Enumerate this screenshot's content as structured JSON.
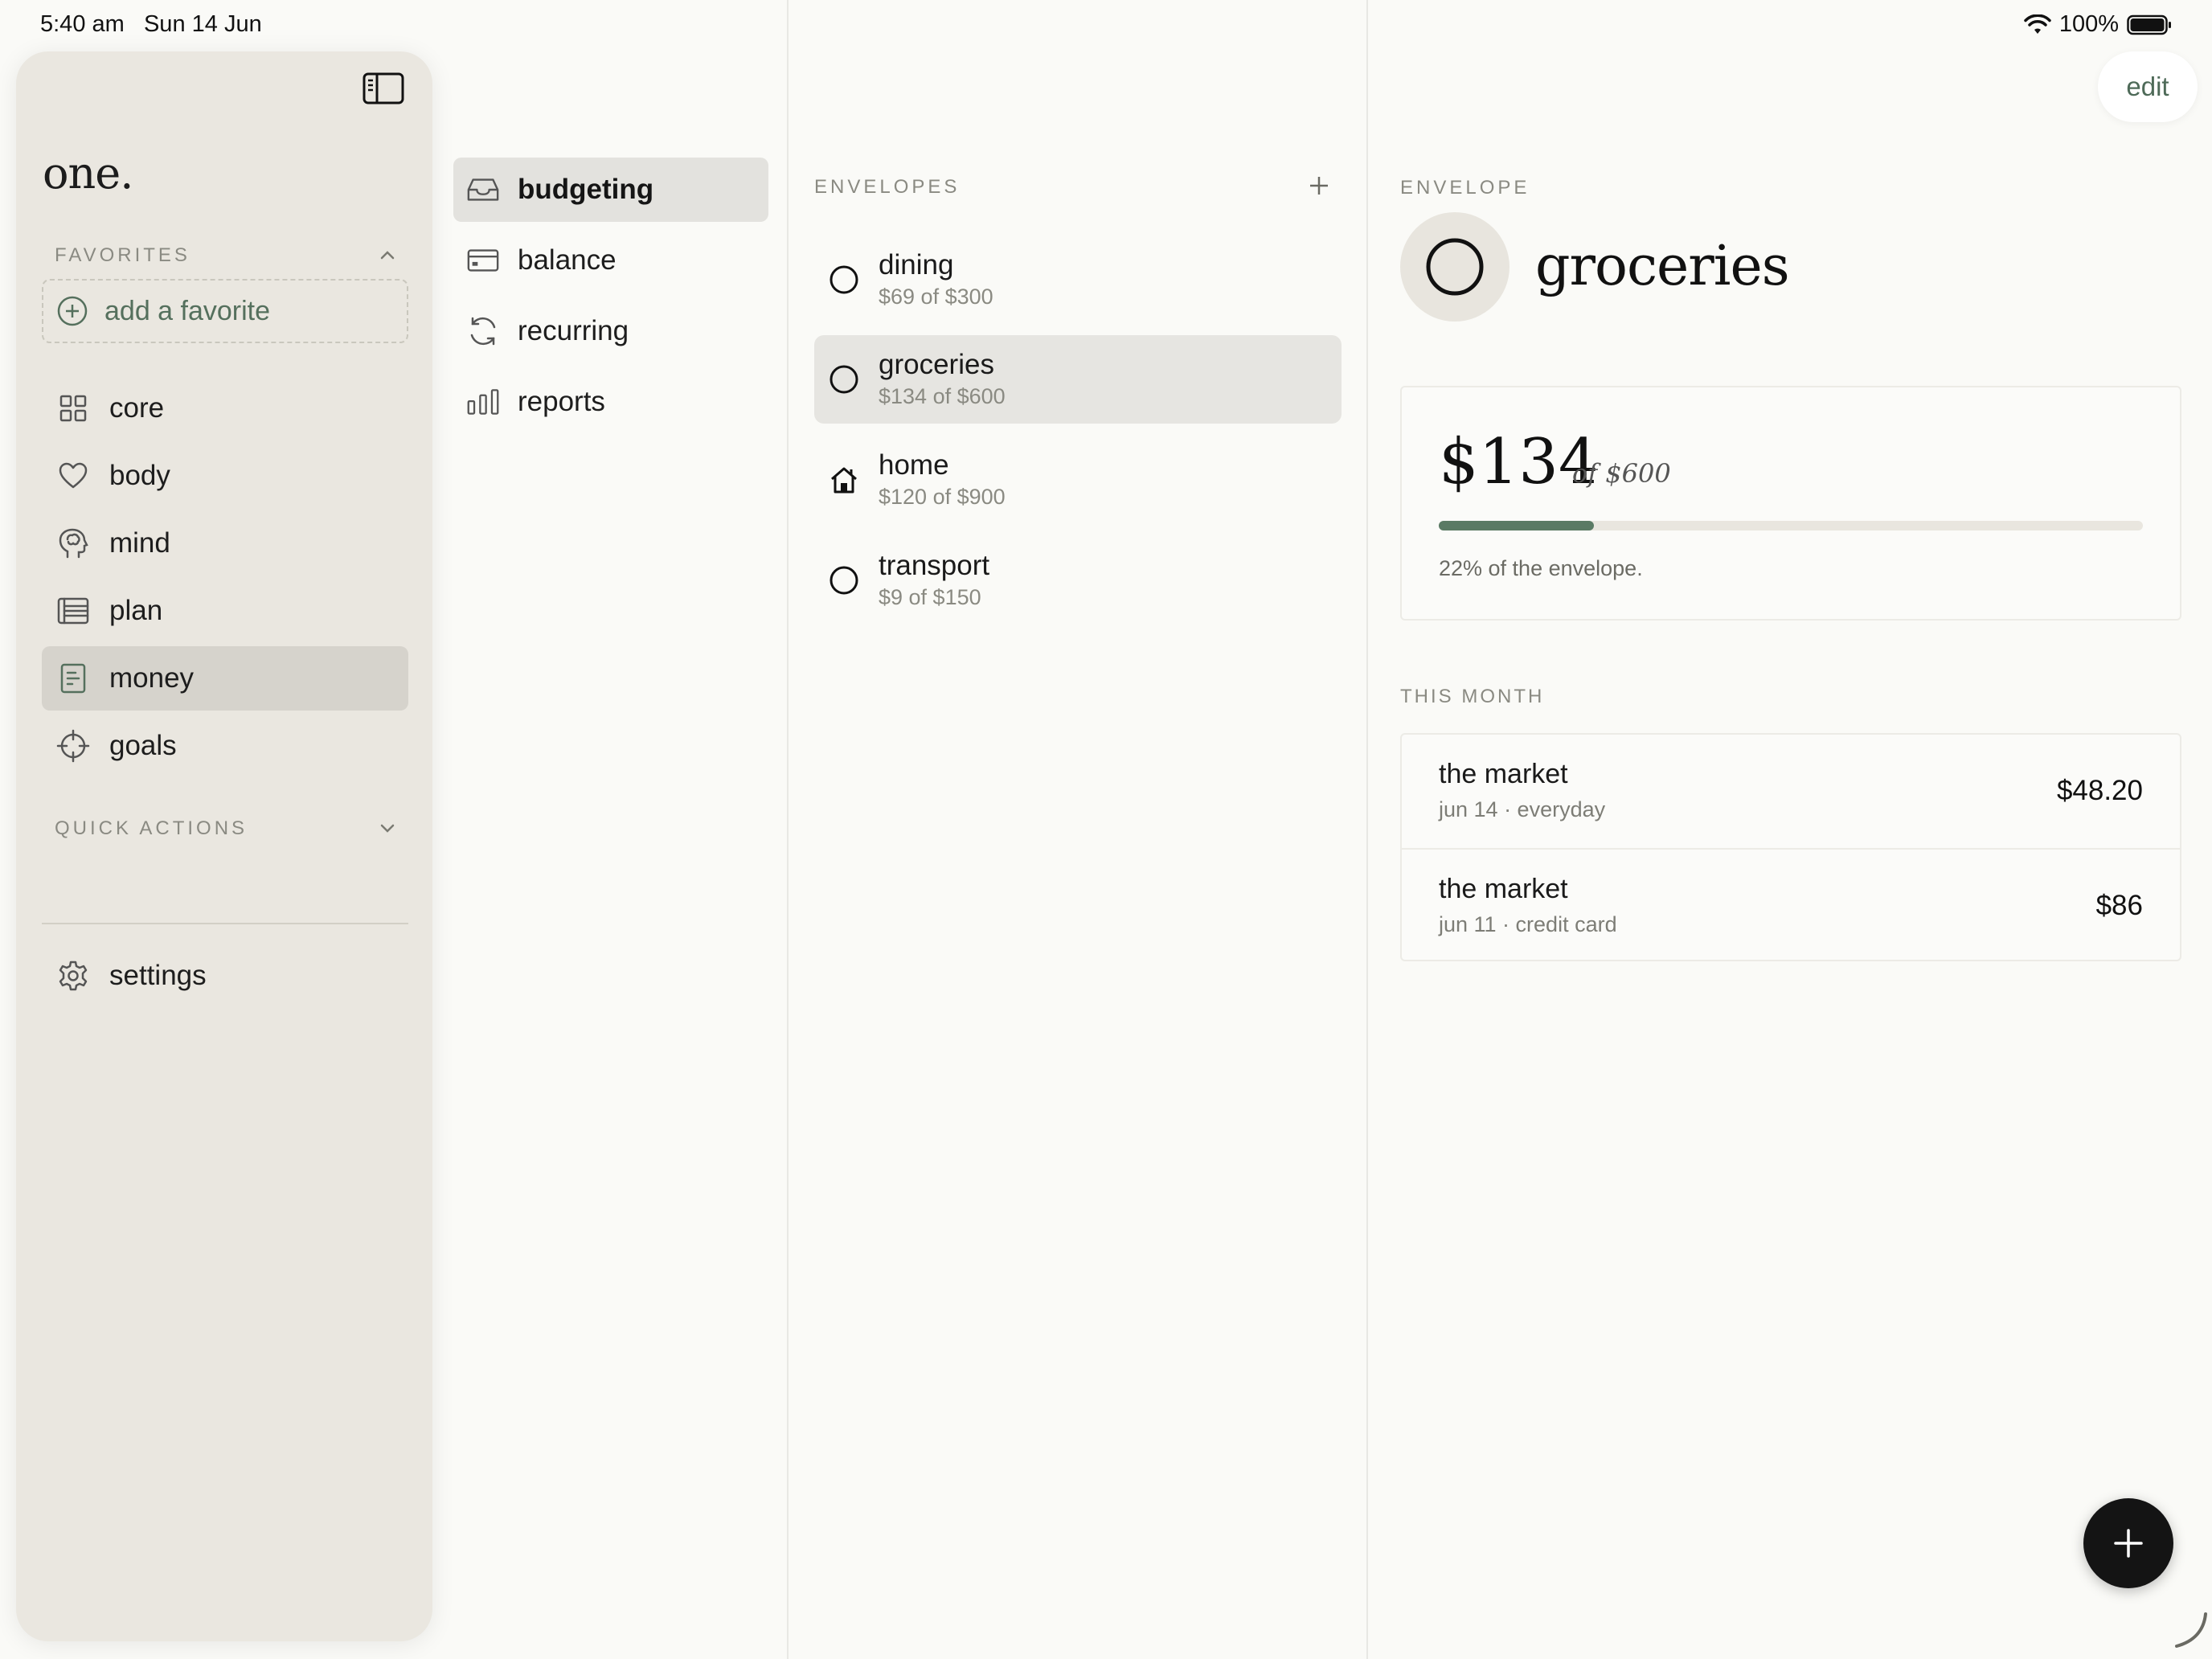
{
  "status_bar": {
    "time": "5:40 am",
    "date": "Sun 14 Jun",
    "battery": "100%"
  },
  "sidebar": {
    "app_title": "one.",
    "favorites_label": "FAVORITES",
    "add_favorite": "add a favorite",
    "items": [
      {
        "label": "core",
        "icon": "grid-icon"
      },
      {
        "label": "body",
        "icon": "heart-icon"
      },
      {
        "label": "mind",
        "icon": "brain-head-icon"
      },
      {
        "label": "plan",
        "icon": "list-icon"
      },
      {
        "label": "money",
        "icon": "receipt-icon",
        "active": true
      },
      {
        "label": "goals",
        "icon": "target-icon"
      }
    ],
    "quick_actions_label": "QUICK ACTIONS",
    "settings": "settings"
  },
  "subnav": {
    "items": [
      {
        "label": "budgeting",
        "icon": "tray-icon",
        "active": true
      },
      {
        "label": "balance",
        "icon": "card-icon"
      },
      {
        "label": "recurring",
        "icon": "refresh-icon"
      },
      {
        "label": "reports",
        "icon": "bar-chart-icon"
      }
    ]
  },
  "envelopes": {
    "header": "ENVELOPES",
    "items": [
      {
        "name": "dining",
        "sub": "$69 of $300",
        "icon": "circle-icon"
      },
      {
        "name": "groceries",
        "sub": "$134 of $600",
        "icon": "circle-icon",
        "active": true
      },
      {
        "name": "home",
        "sub": "$120 of $900",
        "icon": "house-icon"
      },
      {
        "name": "transport",
        "sub": "$9 of $150",
        "icon": "circle-icon"
      }
    ]
  },
  "detail": {
    "edit": "edit",
    "label": "ENVELOPE",
    "title": "groceries",
    "amount": "$134",
    "amount_of": "of $600",
    "progress_fraction": 0.22,
    "progress_text": "22% of the envelope.",
    "month_label": "THIS MONTH",
    "transactions": [
      {
        "name": "the market",
        "sub": "jun 14 · everyday",
        "amount": "$48.20"
      },
      {
        "name": "the market",
        "sub": "jun 11 · credit card",
        "amount": "$86"
      }
    ]
  },
  "colors": {
    "accent": "#5a7a64",
    "sidebar_bg": "#eae7e0",
    "page_bg": "#fafaf7"
  }
}
